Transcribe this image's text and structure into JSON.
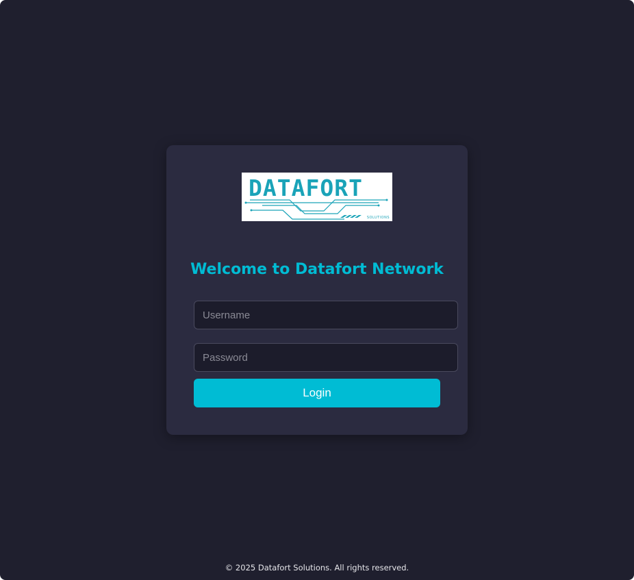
{
  "colors": {
    "page_background": "#1f1f2e",
    "card_background": "#2b2b40",
    "accent": "#00bcd4",
    "field_background": "#1c1c2b",
    "logo_accent": "#1aa3b8"
  },
  "logo": {
    "wordmark": "DATAFORT",
    "tagline": "SOLUTIONS"
  },
  "login": {
    "title": "Welcome to Datafort Network",
    "username_placeholder": "Username",
    "password_placeholder": "Password",
    "button_label": "Login"
  },
  "footer": {
    "text": "© 2025 Datafort Solutions. All rights reserved."
  }
}
